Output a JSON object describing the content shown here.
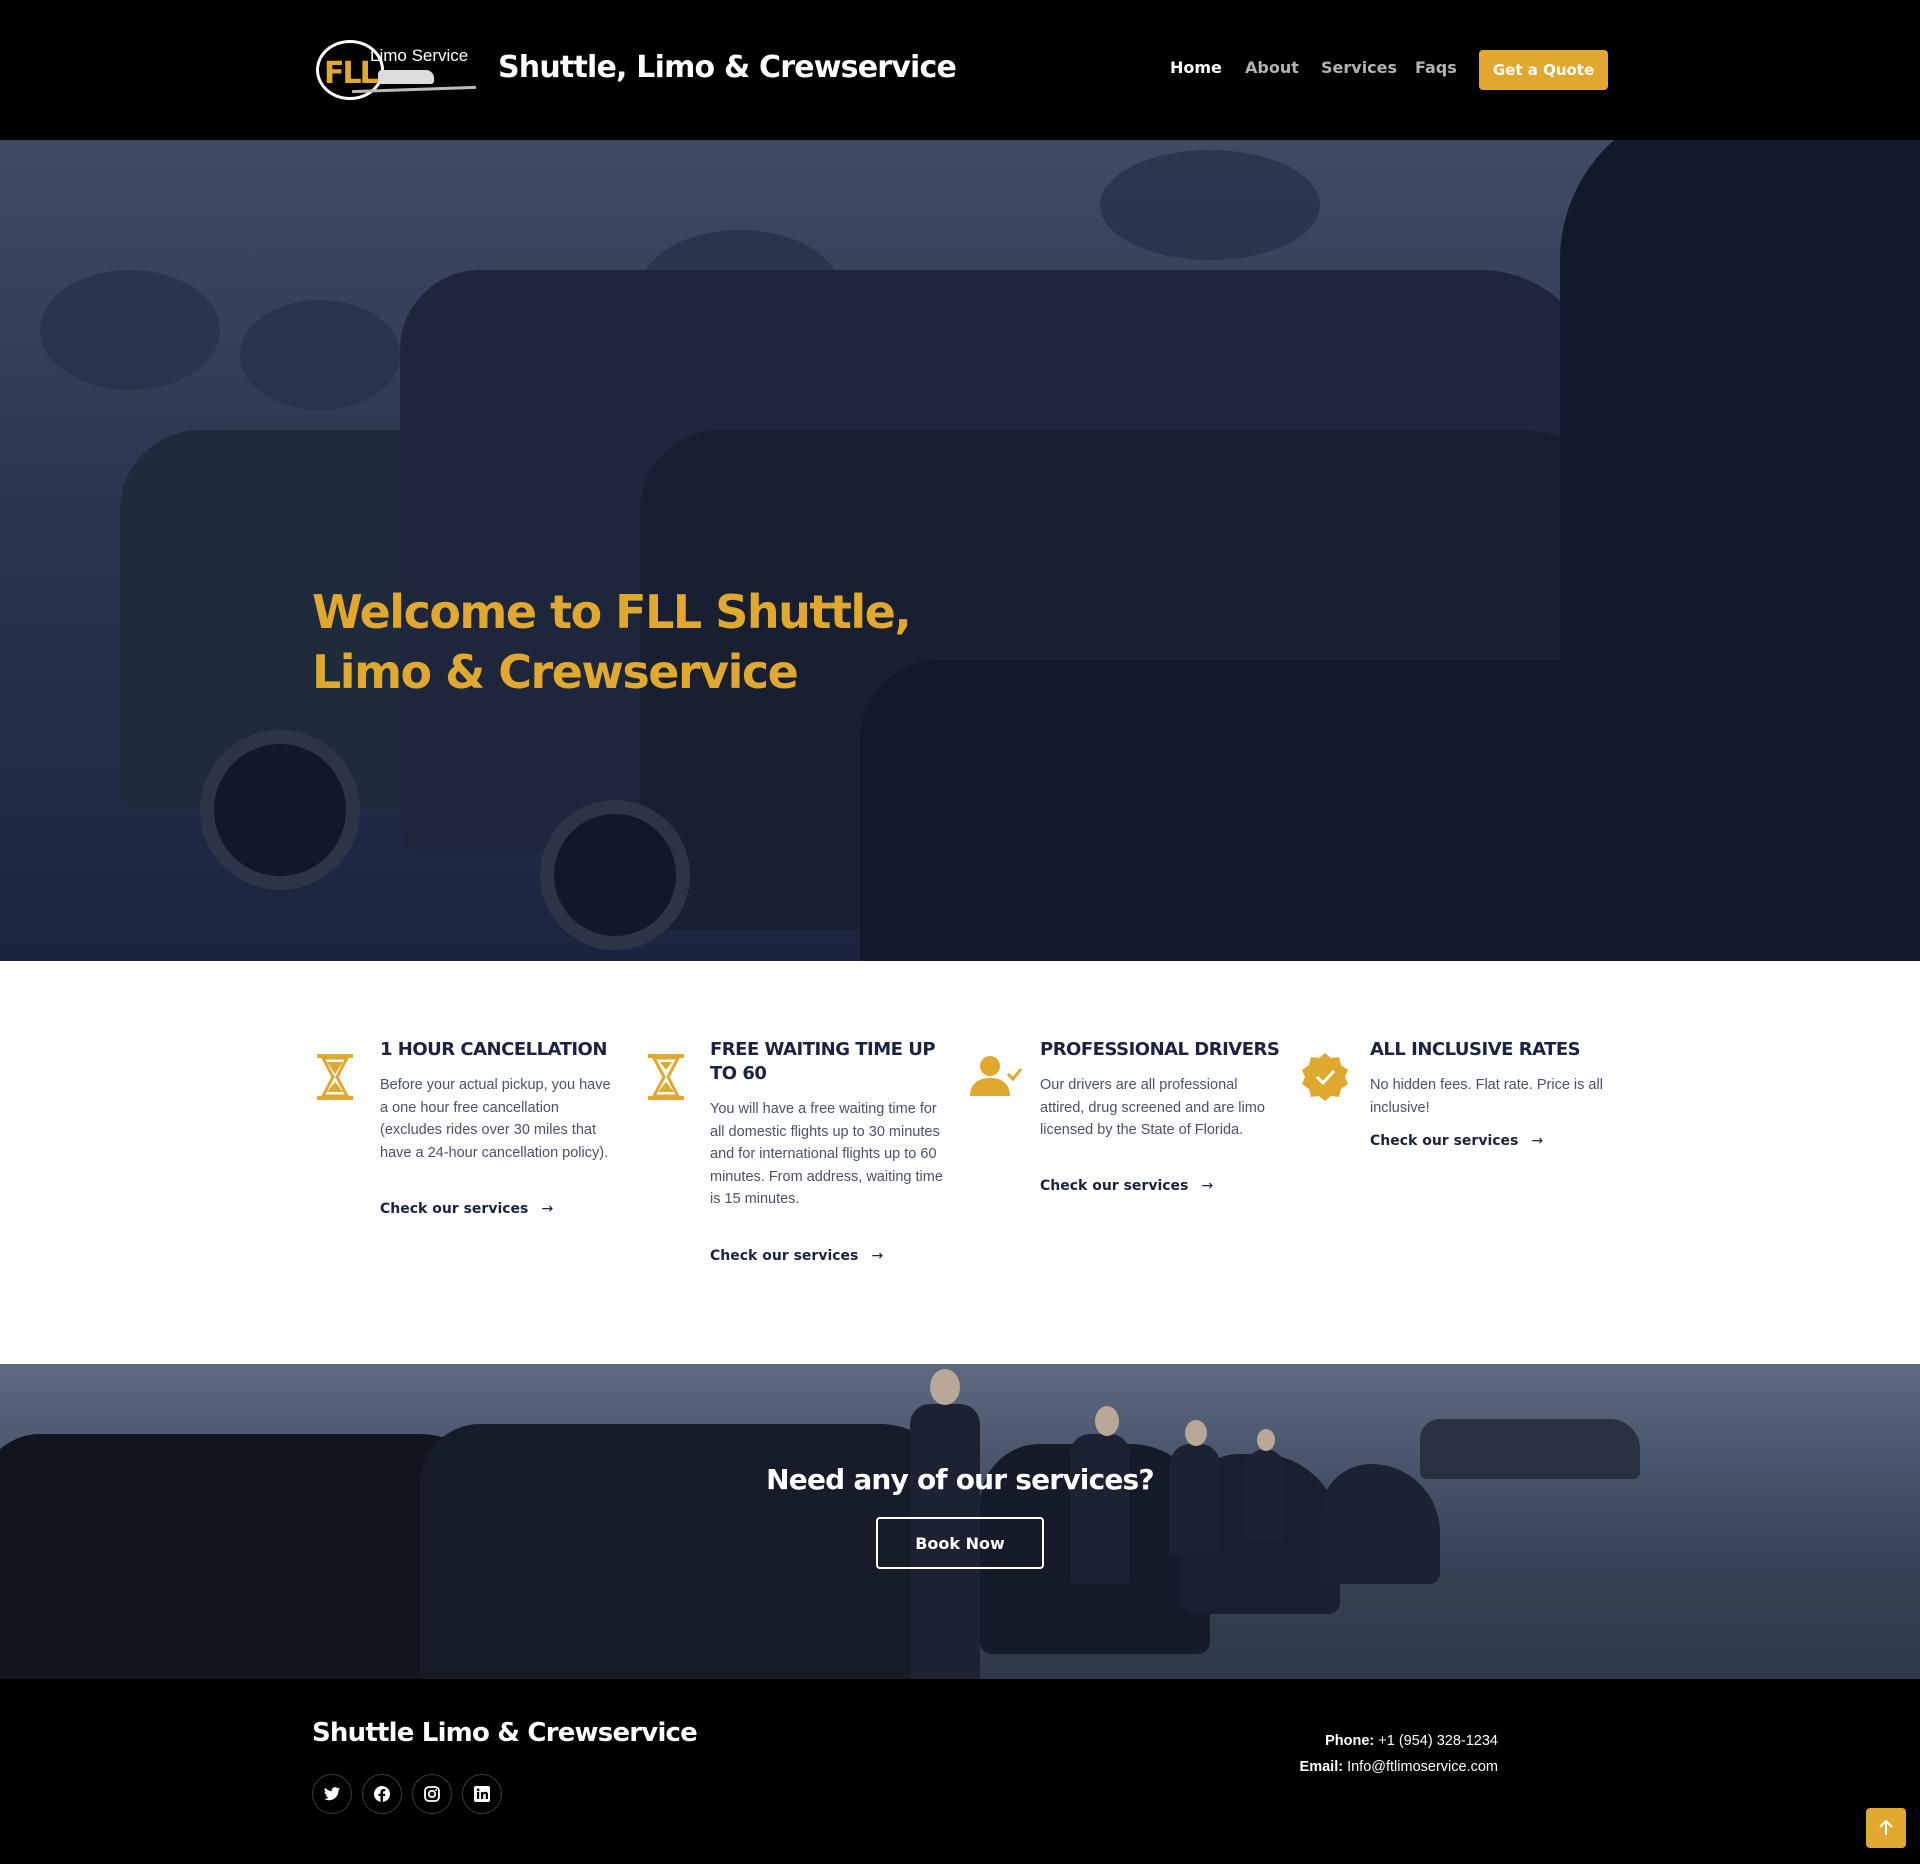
{
  "header": {
    "logo": {
      "main": "FLL",
      "sub": "Limo Service"
    },
    "site_title": "Shuttle, Limo & Crewservice",
    "nav": [
      "Home",
      "About",
      "Services",
      "Faqs"
    ],
    "cta_label": "Get a Quote",
    "active_nav": "Home"
  },
  "hero": {
    "title": "Welcome to FLL Shuttle, Limo & Crewservice"
  },
  "features": [
    {
      "icon": "hourglass-icon",
      "title": "1 HOUR CANCELLATION",
      "text": "Before your actual pickup, you have a one hour free cancellation (excludes rides over 30 miles that have a 24-hour cancellation policy).",
      "link": "Check our services"
    },
    {
      "icon": "hourglass-icon",
      "title": "FREE WAITING TIME UP TO 60",
      "text": "You will have a free waiting time for all domestic flights up to 30 minutes and for international flights up to 60 minutes. From address, waiting time is 15 minutes.",
      "link": "Check our services"
    },
    {
      "icon": "user-check-icon",
      "title": "PROFESSIONAL DRIVERS",
      "text": "Our drivers are all professional attired, drug screened and are limo licensed by the State of Florida.",
      "link": "Check our services"
    },
    {
      "icon": "badge-check-icon",
      "title": "ALL INCLUSIVE RATES",
      "text": "No hidden fees. Flat rate. Price is all inclusive!",
      "link": "Check our services"
    }
  ],
  "cta": {
    "title": "Need any of our services?",
    "button": "Book Now"
  },
  "footer": {
    "title": "Shuttle Limo & Crewservice",
    "social": [
      "twitter-icon",
      "facebook-icon",
      "instagram-icon",
      "linkedin-icon"
    ],
    "phone_label": "Phone:",
    "phone": "+1 (954) 328-1234",
    "email_label": "Email:",
    "email": "Info@ftlimoservice.com"
  },
  "colors": {
    "accent": "#e0a82e",
    "navy": "#1a2440",
    "background": "#000000"
  }
}
